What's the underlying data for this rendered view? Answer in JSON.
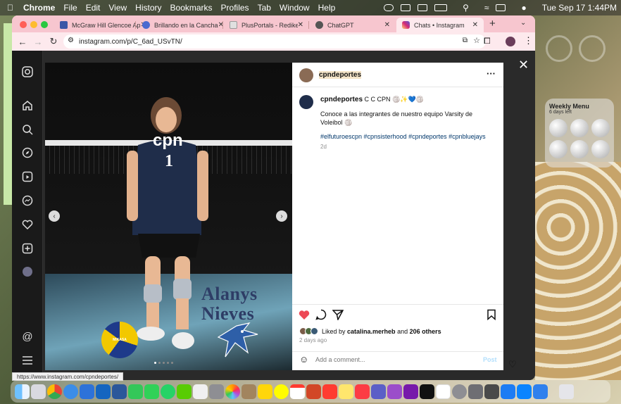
{
  "menubar": {
    "app": "Chrome",
    "menus": [
      "File",
      "Edit",
      "View",
      "History",
      "Bookmarks",
      "Profiles",
      "Tab",
      "Window",
      "Help"
    ],
    "clock": "Tue Sep 17  1:44PM"
  },
  "browser": {
    "tabs": [
      {
        "title": "McGraw Hill Glencoe Ap",
        "color": "#3b57a7"
      },
      {
        "title": "Brillando en la Cancha",
        "color": "#4a6ad0"
      },
      {
        "title": "PlusPortals - Rediker S",
        "color": "#e0e0e0"
      },
      {
        "title": "ChatGPT",
        "color": "#555555"
      },
      {
        "title": "Chats • Instagram",
        "color": "#d6249f"
      }
    ],
    "new_tab": "+",
    "url": "instagram.com/p/C_6ad_USvTN/",
    "status_url": "https://www.instagram.com/cpndeportes/"
  },
  "post": {
    "author": "cpndeportes",
    "caption_user": "cpndeportes",
    "caption_suffix": "C C CPN 🏐✨💙🏐",
    "caption": "Conoce a las integrantes de nuestro equipo Varsity de Voleibol 🏐",
    "hashtags": "#elfuturoescpn #cpnsisterhood #cpndeportes #cpnbluejays",
    "time_short": "2d",
    "liked_prefix": "Liked by ",
    "liked_user": "catalina.merheb",
    "liked_and": " and ",
    "liked_others": "206 others",
    "time_long": "2 days ago",
    "comment_placeholder": "Add a comment...",
    "post_button": "Post",
    "photo_first": "Alanys",
    "photo_last": "Nieves",
    "jersey_text": "cpn",
    "jersey_number": "1",
    "ball_brand": "MIKASA"
  },
  "widget": {
    "title": "Weekly Menu",
    "subtitle": "6 days left"
  },
  "colors": {
    "tabbar": "#f7c6cf",
    "like_red": "#ed4956",
    "link_blue": "#00376b"
  }
}
